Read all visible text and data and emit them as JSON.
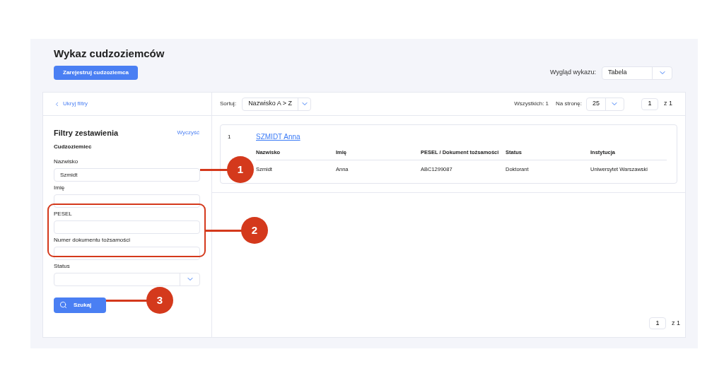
{
  "page": {
    "title": "Wykaz cudzoziemców",
    "register_button": "Zarejestruj cudzoziemca",
    "view_label": "Wygląd wykazu:",
    "view_value": "Tabela"
  },
  "filters": {
    "hide_link": "Ukryj filtry",
    "title": "Filtry zestawienia",
    "clear_link": "Wyczyść",
    "section": "Cudzoziemiec",
    "fields": [
      {
        "kind": "text",
        "label": "Nazwisko",
        "value": "Szmidt"
      },
      {
        "kind": "text",
        "label": "Imię"
      },
      {
        "kind": "text",
        "label": "PESEL"
      },
      {
        "kind": "text",
        "label": "Numer dokumentu tożsamości"
      },
      {
        "kind": "select",
        "label": "Status"
      }
    ],
    "search_button": "Szukaj"
  },
  "toolbar": {
    "sort_label": "Sortuj:",
    "sort_value": "Nazwisko A > Z",
    "total": "Wszystkich: 1",
    "per_page_label": "Na stronę:",
    "per_page_value": "25",
    "page": "1",
    "page_of": "z 1"
  },
  "results": [
    {
      "number": "1",
      "name": "SZMIDT Anna",
      "columns": [
        "Nazwisko",
        "Imię",
        "PESEL / Dokument tożsamości",
        "Status",
        "Instytucja"
      ],
      "values": [
        "Szmidt",
        "Anna",
        "ABC1299087",
        "Doktorant",
        "Uniwersytet Warszawski"
      ]
    }
  ],
  "bottom_pager": {
    "page": "1",
    "page_of": "z 1"
  },
  "callouts": [
    "1",
    "2",
    "3"
  ]
}
